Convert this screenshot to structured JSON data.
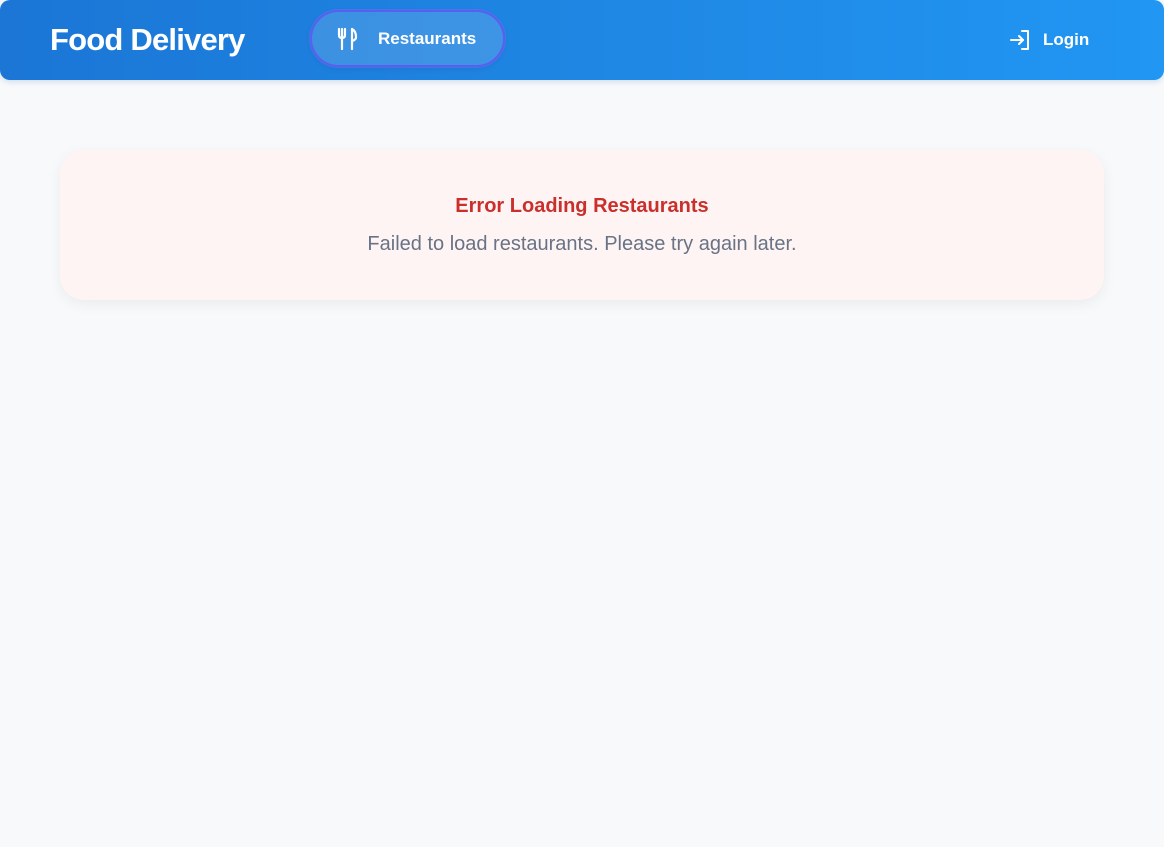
{
  "navbar": {
    "brand": "Food Delivery",
    "restaurants_label": "Restaurants",
    "restaurants_icon": "fork-knife-icon",
    "login_label": "Login",
    "login_icon": "login-icon"
  },
  "error": {
    "title": "Error Loading Restaurants",
    "message": "Failed to load restaurants. Please try again later."
  },
  "colors": {
    "navbar_start": "#1b76d6",
    "navbar_end": "#2196f3",
    "active_outline": "#5b5ff0",
    "error_title": "#c9302c",
    "error_background": "#fff4f4",
    "message_text": "#687385",
    "page_background": "#f8f9fb"
  }
}
